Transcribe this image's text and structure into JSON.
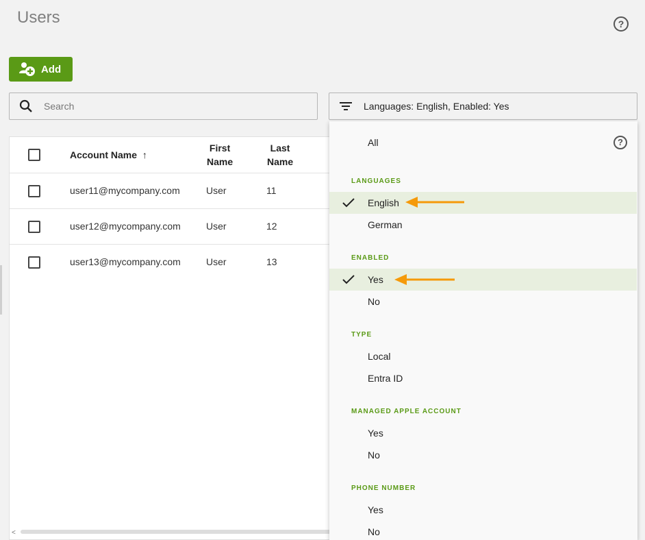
{
  "page": {
    "title": "Users"
  },
  "toolbar": {
    "add_label": "Add"
  },
  "search": {
    "placeholder": "Search",
    "value": ""
  },
  "filter": {
    "summary": "Languages: English, Enabled: Yes"
  },
  "table": {
    "columns": {
      "account_name": "Account Name",
      "first_name_line1": "First",
      "first_name_line2": "Name",
      "last_name_line1": "Last",
      "last_name_line2": "Name"
    },
    "sort_indicator": "↑",
    "rows": [
      {
        "account": "user11@mycompany.com",
        "first": "User",
        "last": "11"
      },
      {
        "account": "user12@mycompany.com",
        "first": "User",
        "last": "12"
      },
      {
        "account": "user13@mycompany.com",
        "first": "User",
        "last": "13"
      }
    ]
  },
  "dropdown": {
    "all_label": "All",
    "languages": {
      "heading": "LANGUAGES",
      "options": [
        "English",
        "German"
      ],
      "selected": "English"
    },
    "enabled": {
      "heading": "ENABLED",
      "options": [
        "Yes",
        "No"
      ],
      "selected": "Yes"
    },
    "type": {
      "heading": "TYPE",
      "options": [
        "Local",
        "Entra ID"
      ]
    },
    "managed_apple_account": {
      "heading": "MANAGED APPLE ACCOUNT",
      "options": [
        "Yes",
        "No"
      ]
    },
    "phone_number": {
      "heading": "PHONE NUMBER",
      "options": [
        "Yes",
        "No"
      ]
    }
  },
  "colors": {
    "accent": "#5a9a16",
    "selected_bg": "#e8efdf",
    "annotation_arrow": "#f59a0a"
  },
  "icons": [
    "help-icon",
    "add-user-icon",
    "search-icon",
    "filter-icon",
    "checkmark-icon",
    "sort-ascending-icon"
  ]
}
